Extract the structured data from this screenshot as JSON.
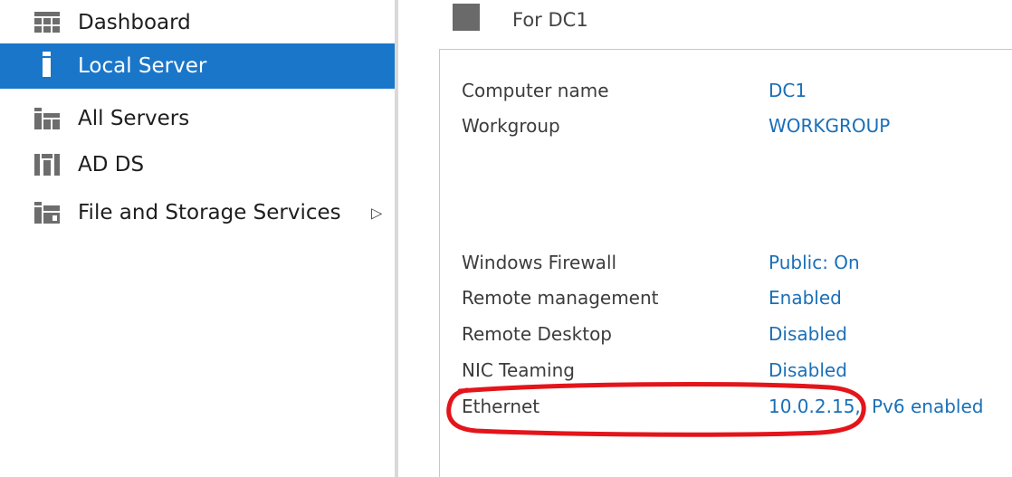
{
  "sidebar": {
    "items": [
      {
        "label": "Dashboard",
        "icon": "dashboard-icon",
        "active": false
      },
      {
        "label": "Local Server",
        "icon": "local-server-icon",
        "active": true
      },
      {
        "label": "All Servers",
        "icon": "all-servers-icon",
        "active": false
      },
      {
        "label": "AD DS",
        "icon": "ad-ds-icon",
        "active": false
      },
      {
        "label": "File and Storage Services",
        "icon": "file-storage-icon",
        "active": false,
        "expand_arrow": "▷"
      }
    ]
  },
  "main": {
    "header_title": "For DC1",
    "properties_top": [
      {
        "label": "Computer name",
        "value": "DC1"
      },
      {
        "label": "Workgroup",
        "value": "WORKGROUP"
      }
    ],
    "properties_bottom": [
      {
        "label": "Windows Firewall",
        "value": "Public: On"
      },
      {
        "label": "Remote management",
        "value": "Enabled"
      },
      {
        "label": "Remote Desktop",
        "value": "Disabled"
      },
      {
        "label": "NIC Teaming",
        "value": "Disabled"
      },
      {
        "label": "Ethernet",
        "value": "10.0.2.15,",
        "value2": "Pv6 enabled"
      }
    ]
  },
  "colors": {
    "accent": "#1a76c9",
    "link": "#1a6fb8",
    "annotation": "#e3151b"
  }
}
